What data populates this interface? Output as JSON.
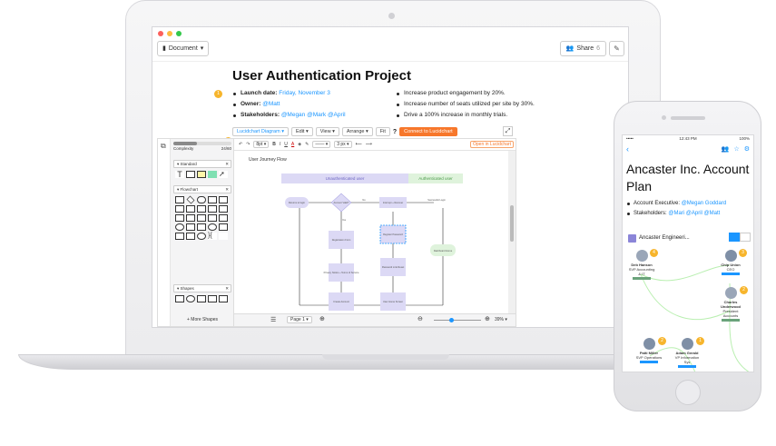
{
  "laptop": {
    "toolbar": {
      "document_label": "Document",
      "share_label": "Share",
      "share_count": "6"
    },
    "doc": {
      "title": "User Authentication Project",
      "badge_1": "1",
      "badge_2": "2",
      "left_bullets": [
        {
          "label": "Launch date:",
          "value": "Friday, November 3"
        },
        {
          "label": "Owner:",
          "value": "@Matt"
        },
        {
          "label": "Stakeholders:",
          "value": "@Megan @Mark @April"
        }
      ],
      "right_bullets": [
        "Increase product engagement by 20%.",
        "Increase number of seats utilized per site by 30%.",
        "Drive a 100% increase in monthly trials."
      ]
    },
    "lucid": {
      "diagram_label": "Lucidchart Diagram",
      "menu": [
        "Edit",
        "View",
        "Arrange",
        "Fit"
      ],
      "connect_label": "Connect to Lucidchart",
      "open_label": "Open in Lucidchart",
      "font_size": "8pt",
      "line_width": "3 px",
      "complexity_label": "Complexity",
      "complexity_value": "24/60",
      "sections": [
        "Standard",
        "Flowchart",
        "Shapes"
      ],
      "more_shapes": "More Shapes",
      "page_label": "Page 1",
      "zoom": "39%",
      "diagram": {
        "title": "User Journey Flow",
        "lane_unauth": "Unauthenticated user",
        "lane_auth": "Authenticated user",
        "nodes": [
          "Returns to login",
          "Account Valid?",
          "Interrupt + Recover",
          "Successful Login",
          "Registration Form",
          "Register Password",
          "Dashboard Home",
          "Privacy Notice + Terms of Service",
          "Password Link Reset",
          "Create Account",
          "User Home Screen"
        ],
        "edge_labels": [
          "Yes",
          "No"
        ]
      }
    }
  },
  "phone": {
    "status": {
      "carrier": "•••••",
      "time": "12:43 PM",
      "battery": "100%"
    },
    "title": "Ancaster Inc. Account Plan",
    "bullets": [
      {
        "label": "Account Executive:",
        "value": "@Megan Goddard"
      },
      {
        "label": "Stakeholders:",
        "value": "@Mari @April @Matt"
      }
    ],
    "chart_title": "Ancaster Engineeri...",
    "people": [
      {
        "name": "Deb Hanson",
        "role": "SVP Accounting & IT"
      },
      {
        "name": "Chip Union",
        "role": "CEO"
      },
      {
        "name": "Charles Underwood",
        "role": "President Accounts"
      },
      {
        "name": "Patti Miller",
        "role": "SVP Operations"
      },
      {
        "name": "Adam Gerald",
        "role": "VP Information Sys"
      }
    ],
    "badges": [
      "4",
      "3",
      "2",
      "2",
      "1"
    ]
  },
  "colors": {
    "accent_blue": "#1b96ff",
    "lucid_orange": "#f7772b",
    "badge_yellow": "#f7b52c",
    "lane_purple": "#dcd9f5",
    "lane_green": "#dff3dc"
  }
}
